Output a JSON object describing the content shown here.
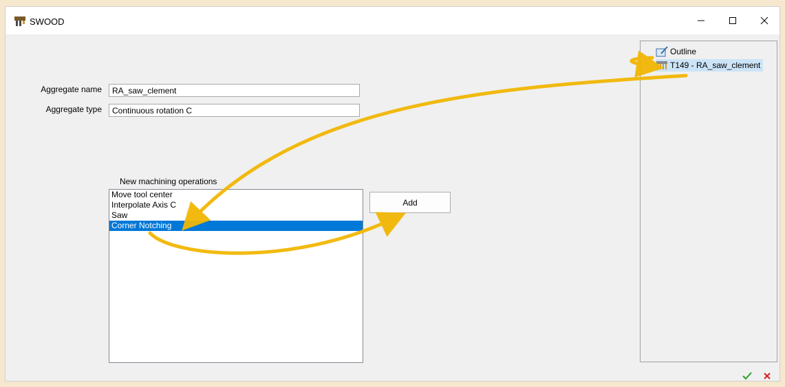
{
  "window": {
    "title": "SWOOD"
  },
  "form": {
    "aggregate_name_label": "Aggregate name",
    "aggregate_name_value": "RA_saw_clement",
    "aggregate_type_label": "Aggregate type",
    "aggregate_type_value": "Continuous rotation C"
  },
  "operations": {
    "label": "New machining operations",
    "items": [
      "Move tool center",
      "Interpolate Axis C",
      "Saw",
      "Corner Notching"
    ],
    "selected": "Corner Notching"
  },
  "add_button": {
    "label": "Add"
  },
  "tree": {
    "items": [
      {
        "label": "Outline",
        "icon": "outline-icon"
      },
      {
        "label": "T149 - RA_saw_clement",
        "icon": "aggregate-tool-icon"
      }
    ]
  },
  "footer": {
    "ok_icon": "check-icon",
    "cancel_icon": "x-icon",
    "ok_color": "#2aa12a",
    "cancel_color": "#d42020"
  },
  "annotation": {
    "arrow_color": "#f2b705"
  }
}
